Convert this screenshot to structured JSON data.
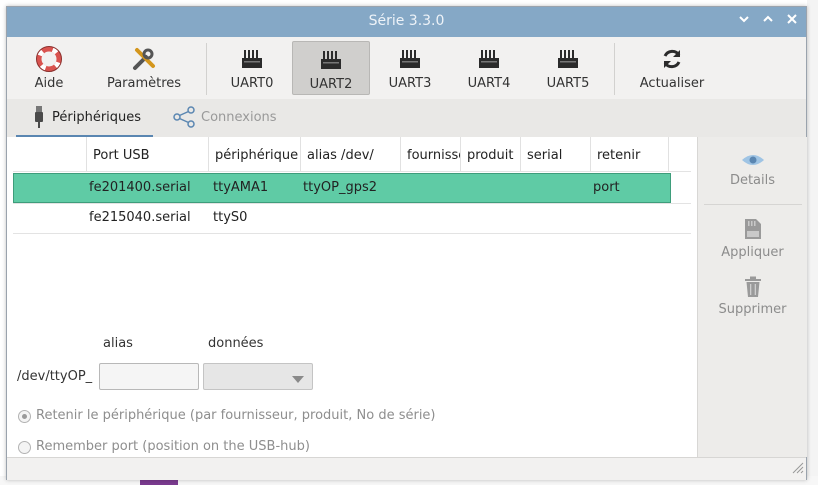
{
  "window": {
    "title": "Série 3.3.0"
  },
  "toolbar": {
    "buttons": [
      {
        "label": "Aide",
        "icon": "lifebuoy-icon"
      },
      {
        "label": "Paramètres",
        "icon": "tools-icon"
      },
      {
        "label": "UART0",
        "icon": "connector-icon"
      },
      {
        "label": "UART2",
        "icon": "connector-icon",
        "active": true
      },
      {
        "label": "UART3",
        "icon": "connector-icon"
      },
      {
        "label": "UART4",
        "icon": "connector-icon"
      },
      {
        "label": "UART5",
        "icon": "connector-icon"
      },
      {
        "label": "Actualiser",
        "icon": "refresh-icon"
      }
    ]
  },
  "tabs": [
    {
      "label": "Périphériques",
      "icon": "usb-plug-icon",
      "selected": true
    },
    {
      "label": "Connexions",
      "icon": "share-icon",
      "selected": false
    }
  ],
  "table": {
    "columns": [
      "Port USB",
      "périphérique",
      "alias /dev/",
      "fournisseur",
      "produit",
      "serial",
      "retenir"
    ],
    "rows": [
      {
        "port": "fe201400.serial",
        "device": "ttyAMA1",
        "alias": "ttyOP_gps2",
        "vendor": "",
        "product": "",
        "serial": "",
        "retain": "port",
        "selected": true
      },
      {
        "port": "fe215040.serial",
        "device": "ttyS0",
        "alias": "",
        "vendor": "",
        "product": "",
        "serial": "",
        "retain": "",
        "selected": false
      }
    ]
  },
  "form": {
    "alias_label": "alias",
    "data_label": "données",
    "prefix": "/dev/ttyOP_",
    "alias_value": "",
    "data_value": "",
    "radio1": "Retenir le périphérique (par fournisseur, produit, No de série)",
    "radio2": "Remember port (position on the USB-hub)"
  },
  "side": {
    "details": "Details",
    "apply": "Appliquer",
    "delete": "Supprimer"
  },
  "colors": {
    "titlebar": "#85a8c6",
    "selection": "#5fcba5",
    "accent": "#5a86b1"
  }
}
